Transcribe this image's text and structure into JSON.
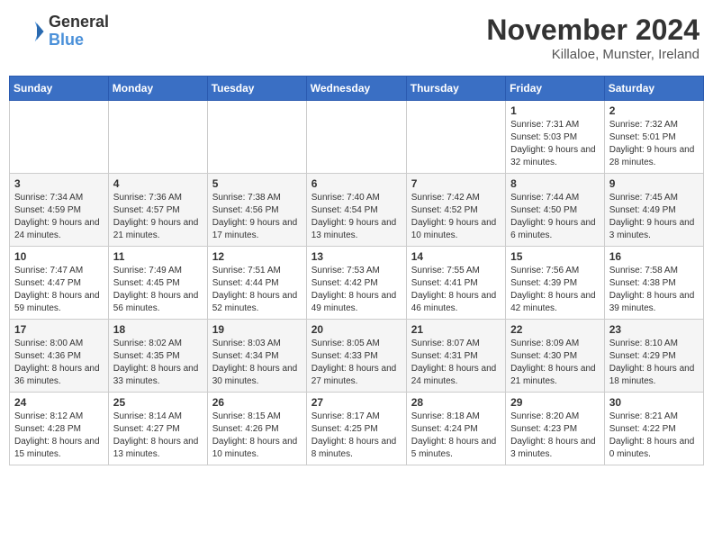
{
  "header": {
    "logo_general": "General",
    "logo_blue": "Blue",
    "month_title": "November 2024",
    "location": "Killaloe, Munster, Ireland"
  },
  "weekdays": [
    "Sunday",
    "Monday",
    "Tuesday",
    "Wednesday",
    "Thursday",
    "Friday",
    "Saturday"
  ],
  "weeks": [
    [
      {
        "day": "",
        "info": ""
      },
      {
        "day": "",
        "info": ""
      },
      {
        "day": "",
        "info": ""
      },
      {
        "day": "",
        "info": ""
      },
      {
        "day": "",
        "info": ""
      },
      {
        "day": "1",
        "info": "Sunrise: 7:31 AM\nSunset: 5:03 PM\nDaylight: 9 hours and 32 minutes."
      },
      {
        "day": "2",
        "info": "Sunrise: 7:32 AM\nSunset: 5:01 PM\nDaylight: 9 hours and 28 minutes."
      }
    ],
    [
      {
        "day": "3",
        "info": "Sunrise: 7:34 AM\nSunset: 4:59 PM\nDaylight: 9 hours and 24 minutes."
      },
      {
        "day": "4",
        "info": "Sunrise: 7:36 AM\nSunset: 4:57 PM\nDaylight: 9 hours and 21 minutes."
      },
      {
        "day": "5",
        "info": "Sunrise: 7:38 AM\nSunset: 4:56 PM\nDaylight: 9 hours and 17 minutes."
      },
      {
        "day": "6",
        "info": "Sunrise: 7:40 AM\nSunset: 4:54 PM\nDaylight: 9 hours and 13 minutes."
      },
      {
        "day": "7",
        "info": "Sunrise: 7:42 AM\nSunset: 4:52 PM\nDaylight: 9 hours and 10 minutes."
      },
      {
        "day": "8",
        "info": "Sunrise: 7:44 AM\nSunset: 4:50 PM\nDaylight: 9 hours and 6 minutes."
      },
      {
        "day": "9",
        "info": "Sunrise: 7:45 AM\nSunset: 4:49 PM\nDaylight: 9 hours and 3 minutes."
      }
    ],
    [
      {
        "day": "10",
        "info": "Sunrise: 7:47 AM\nSunset: 4:47 PM\nDaylight: 8 hours and 59 minutes."
      },
      {
        "day": "11",
        "info": "Sunrise: 7:49 AM\nSunset: 4:45 PM\nDaylight: 8 hours and 56 minutes."
      },
      {
        "day": "12",
        "info": "Sunrise: 7:51 AM\nSunset: 4:44 PM\nDaylight: 8 hours and 52 minutes."
      },
      {
        "day": "13",
        "info": "Sunrise: 7:53 AM\nSunset: 4:42 PM\nDaylight: 8 hours and 49 minutes."
      },
      {
        "day": "14",
        "info": "Sunrise: 7:55 AM\nSunset: 4:41 PM\nDaylight: 8 hours and 46 minutes."
      },
      {
        "day": "15",
        "info": "Sunrise: 7:56 AM\nSunset: 4:39 PM\nDaylight: 8 hours and 42 minutes."
      },
      {
        "day": "16",
        "info": "Sunrise: 7:58 AM\nSunset: 4:38 PM\nDaylight: 8 hours and 39 minutes."
      }
    ],
    [
      {
        "day": "17",
        "info": "Sunrise: 8:00 AM\nSunset: 4:36 PM\nDaylight: 8 hours and 36 minutes."
      },
      {
        "day": "18",
        "info": "Sunrise: 8:02 AM\nSunset: 4:35 PM\nDaylight: 8 hours and 33 minutes."
      },
      {
        "day": "19",
        "info": "Sunrise: 8:03 AM\nSunset: 4:34 PM\nDaylight: 8 hours and 30 minutes."
      },
      {
        "day": "20",
        "info": "Sunrise: 8:05 AM\nSunset: 4:33 PM\nDaylight: 8 hours and 27 minutes."
      },
      {
        "day": "21",
        "info": "Sunrise: 8:07 AM\nSunset: 4:31 PM\nDaylight: 8 hours and 24 minutes."
      },
      {
        "day": "22",
        "info": "Sunrise: 8:09 AM\nSunset: 4:30 PM\nDaylight: 8 hours and 21 minutes."
      },
      {
        "day": "23",
        "info": "Sunrise: 8:10 AM\nSunset: 4:29 PM\nDaylight: 8 hours and 18 minutes."
      }
    ],
    [
      {
        "day": "24",
        "info": "Sunrise: 8:12 AM\nSunset: 4:28 PM\nDaylight: 8 hours and 15 minutes."
      },
      {
        "day": "25",
        "info": "Sunrise: 8:14 AM\nSunset: 4:27 PM\nDaylight: 8 hours and 13 minutes."
      },
      {
        "day": "26",
        "info": "Sunrise: 8:15 AM\nSunset: 4:26 PM\nDaylight: 8 hours and 10 minutes."
      },
      {
        "day": "27",
        "info": "Sunrise: 8:17 AM\nSunset: 4:25 PM\nDaylight: 8 hours and 8 minutes."
      },
      {
        "day": "28",
        "info": "Sunrise: 8:18 AM\nSunset: 4:24 PM\nDaylight: 8 hours and 5 minutes."
      },
      {
        "day": "29",
        "info": "Sunrise: 8:20 AM\nSunset: 4:23 PM\nDaylight: 8 hours and 3 minutes."
      },
      {
        "day": "30",
        "info": "Sunrise: 8:21 AM\nSunset: 4:22 PM\nDaylight: 8 hours and 0 minutes."
      }
    ]
  ]
}
